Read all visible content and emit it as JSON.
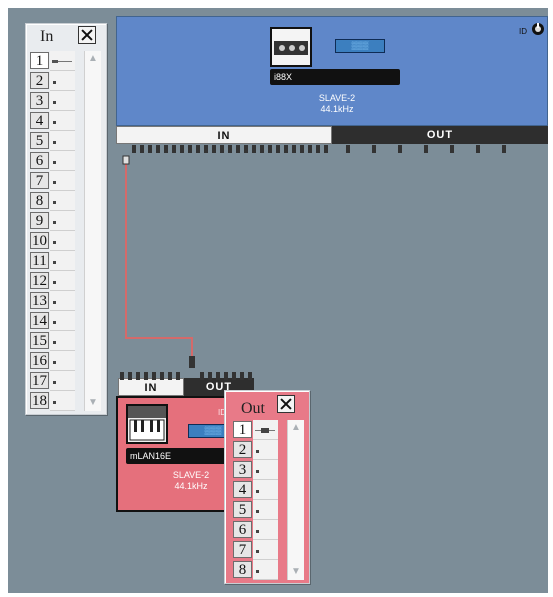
{
  "in_window": {
    "title": "In",
    "ports": [
      "1",
      "2",
      "3",
      "4",
      "5",
      "6",
      "7",
      "8",
      "9",
      "10",
      "11",
      "12",
      "13",
      "14",
      "15",
      "16",
      "17",
      "18"
    ]
  },
  "out_window": {
    "title": "Out",
    "ports": [
      "1",
      "2",
      "3",
      "4",
      "5",
      "6",
      "7",
      "8"
    ]
  },
  "device_main": {
    "name": "i88X",
    "status_line1": "SLAVE-2",
    "status_line2": "44.1kHz",
    "id_label": "ID",
    "tab_in": "IN",
    "tab_out": "OUT"
  },
  "device_mlan": {
    "name": "mLAN16E",
    "status_line1": "SLAVE-2",
    "status_line2": "44.1kHz",
    "id_label": "ID",
    "tab_in": "IN",
    "tab_out": "OUT"
  },
  "colors": {
    "background": "#7c8d98",
    "device_main": "#5f87c9",
    "device_mlan": "#e5707c",
    "cable": "#d46a6a"
  }
}
